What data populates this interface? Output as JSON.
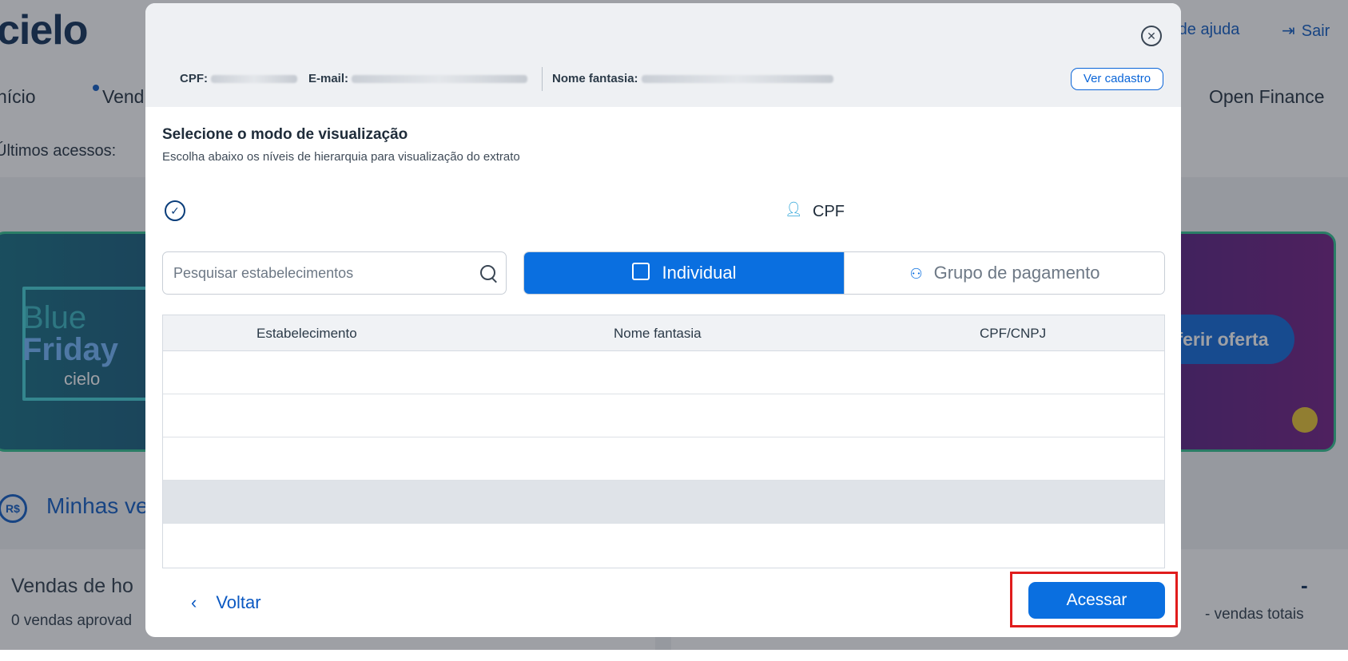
{
  "background": {
    "logo_text": "cielo",
    "help_link": "o de ajuda",
    "exit_label": "Sair",
    "nav": [
      "nício",
      "Vend",
      "Open Finance"
    ],
    "recent_label": "Últimos acessos:",
    "banner": {
      "line1": "Blue",
      "line2": "Friday",
      "brand": "cielo",
      "offer_button": "ferir oferta"
    },
    "section_title": "Minhas ve",
    "currency_icon": "R$",
    "card_title": "Vendas de ho",
    "card_subtitle": "0 vendas aprovad",
    "right_value": "-",
    "right_subtitle": "- vendas totais"
  },
  "modal": {
    "header": {
      "cpf_label": "CPF:",
      "email_label": "E-mail:",
      "fantasy_label": "Nome fantasia:",
      "view_register_button": "Ver cadastro"
    },
    "title": "Selecione o modo de visualização",
    "subtitle": "Escolha abaixo os níveis de hierarquia para visualização do extrato",
    "hierarchy_level": "CPF",
    "search": {
      "placeholder": "Pesquisar estabelecimentos",
      "value": ""
    },
    "toggle": {
      "individual_label": "Individual",
      "group_label": "Grupo de pagamento",
      "selected": "Individual"
    },
    "table": {
      "columns": [
        "Estabelecimento",
        "Nome fantasia",
        "CPF/CNPJ"
      ],
      "rows": 5,
      "selected_row_index": 3
    },
    "back_label": "Voltar",
    "access_button": "Acessar"
  },
  "colors": {
    "primary": "#0a6fe0",
    "highlight": "#e01c1c",
    "overlay": "rgba(40,45,55,0.45)"
  }
}
